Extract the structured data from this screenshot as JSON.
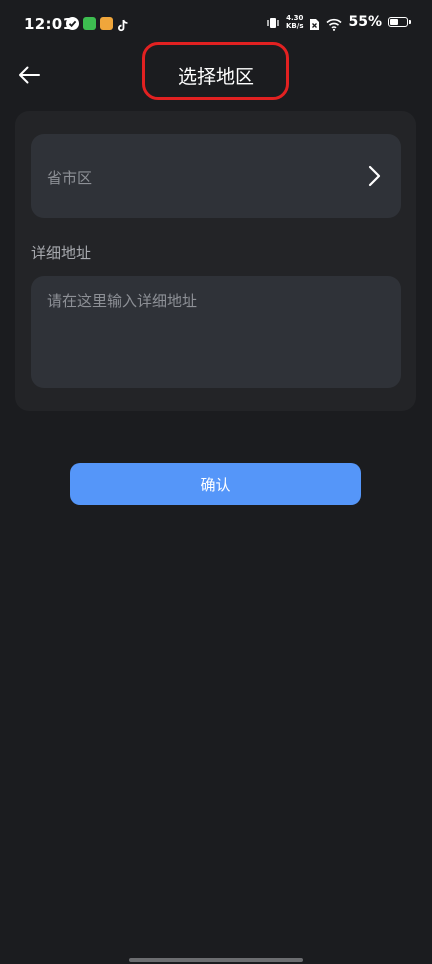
{
  "status_bar": {
    "time": "12:01",
    "net_speed_value": "4.30",
    "net_speed_unit": "KB/s",
    "battery_percent": "55%",
    "battery_level": 0.55,
    "app_icons": [
      "check-circle-icon",
      "wechat-icon",
      "weibo-icon",
      "tiktok-icon"
    ]
  },
  "header": {
    "title": "选择地区",
    "highlight_color": "#e22121"
  },
  "form": {
    "region_placeholder": "省市区",
    "detail_label": "详细地址",
    "detail_placeholder": "请在这里输入详细地址"
  },
  "confirm_label": "确认",
  "colors": {
    "background": "#1b1c1f",
    "card": "#232427",
    "field": "#2f3238",
    "accent": "#5596f9"
  }
}
